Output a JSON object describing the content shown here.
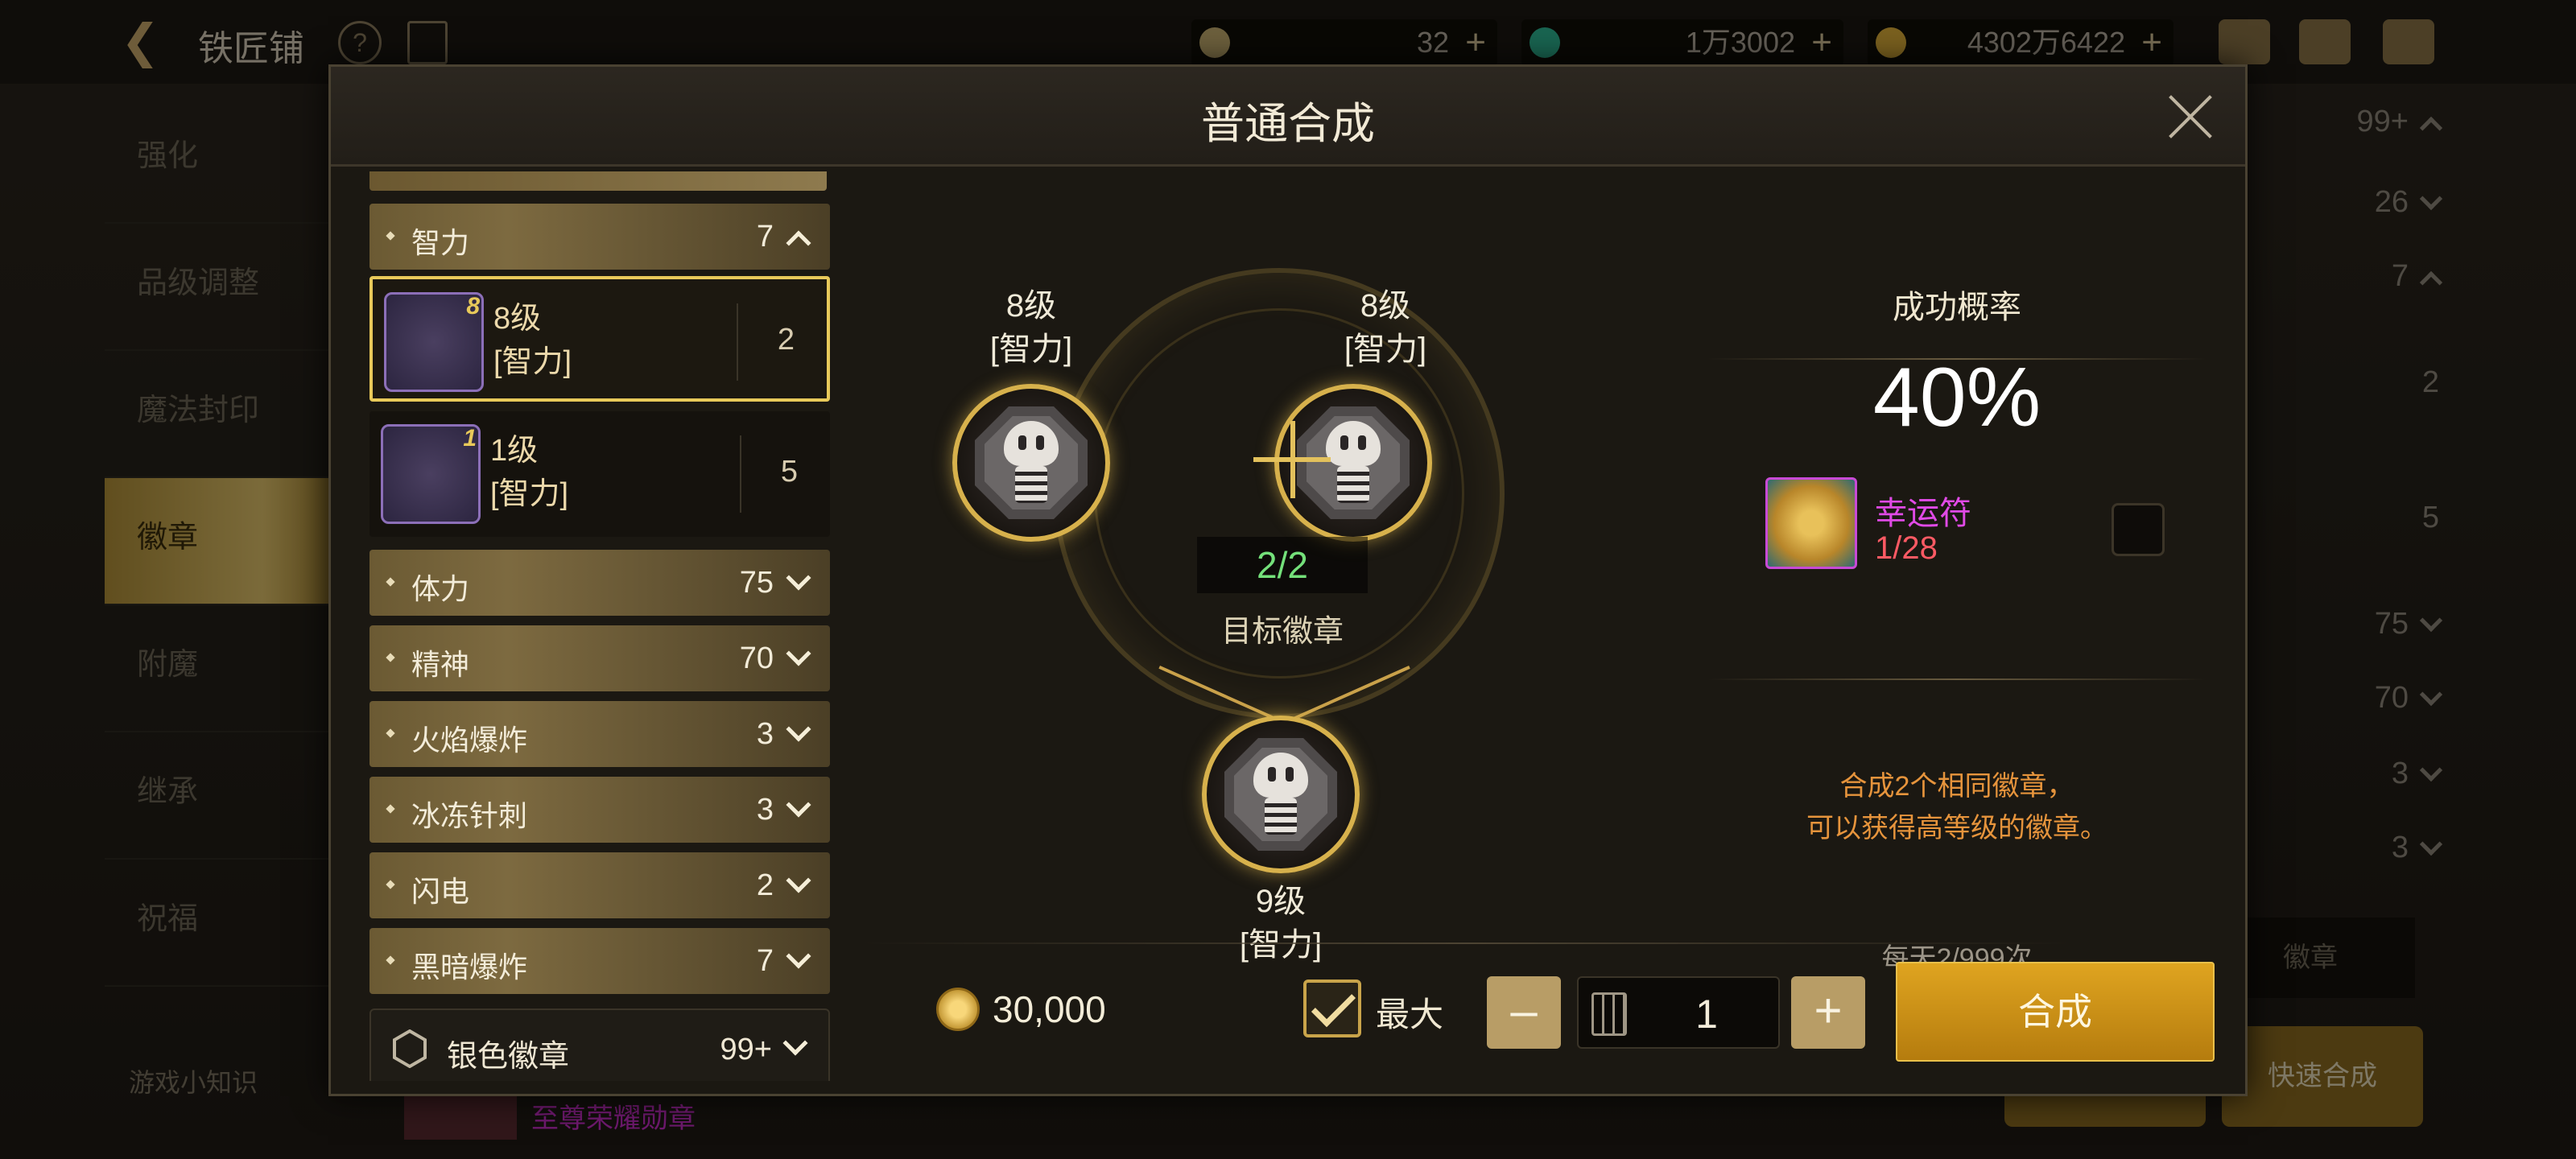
{
  "background": {
    "title": "铁匠铺",
    "currencies": [
      {
        "value": "32"
      },
      {
        "value": "1万3002"
      },
      {
        "value": "4302万6422"
      }
    ],
    "left_menu": [
      "强化",
      "品级调整",
      "魔法封印",
      "徽章",
      "附魔",
      "继承",
      "祝福"
    ],
    "left_menu_active": "徽章",
    "game_tip": "游戏小知识",
    "bottom_item": "至尊荣耀勋章",
    "right_counts": [
      "99+",
      "26",
      "7",
      "2",
      "5",
      "75",
      "70",
      "3",
      "3"
    ],
    "right_label": "徽章",
    "quick_craft": "快速合成"
  },
  "modal": {
    "title": "普通合成",
    "categories": [
      {
        "name": "智力",
        "count": "7",
        "expanded": true
      },
      {
        "name": "体力",
        "count": "75"
      },
      {
        "name": "精神",
        "count": "70"
      },
      {
        "name": "火焰爆炸",
        "count": "3"
      },
      {
        "name": "冰冻针刺",
        "count": "3"
      },
      {
        "name": "闪电",
        "count": "2"
      },
      {
        "name": "黑暗爆炸",
        "count": "7"
      }
    ],
    "items": [
      {
        "level": "8级",
        "attr": "[智力]",
        "qty": "2",
        "badge": "8",
        "selected": true
      },
      {
        "level": "1级",
        "attr": "[智力]",
        "qty": "5",
        "badge": "1"
      }
    ],
    "silver": {
      "name": "银色徽章",
      "count": "99+"
    },
    "slots": {
      "left": {
        "level": "8级",
        "attr": "[智力]"
      },
      "right": {
        "level": "8级",
        "attr": "[智力]"
      },
      "result": {
        "level": "9级",
        "attr": "[智力]"
      }
    },
    "progress": "2/2",
    "target_label": "目标徽章",
    "success_title": "成功概率",
    "success_rate": "40%",
    "charm": {
      "name": "幸运符",
      "count": "1/28"
    },
    "description_line1": "合成2个相同徽章，",
    "description_line2": "可以获得高等级的徽章。",
    "daily_limit": "每天2/999次",
    "gold_cost": "30,000",
    "max_label": "最大",
    "quantity": "1",
    "craft_button": "合成"
  },
  "colors": {
    "accent_gold": "#d7b14c",
    "progress_green": "#74e07a",
    "charm_purple": "#e04ae6",
    "charm_red": "#ff5a64",
    "description_orange": "#e6943c"
  },
  "icons": [
    "back-arrow-icon",
    "help-icon",
    "book-icon",
    "moon-currency-icon",
    "gem-currency-icon",
    "gold-coin-icon",
    "chest-icon",
    "mail-icon",
    "chat-icon",
    "close-icon",
    "chevron-down-icon",
    "chevron-up-icon",
    "badge-icon",
    "charm-icon",
    "calculator-icon",
    "checkmark-icon"
  ]
}
